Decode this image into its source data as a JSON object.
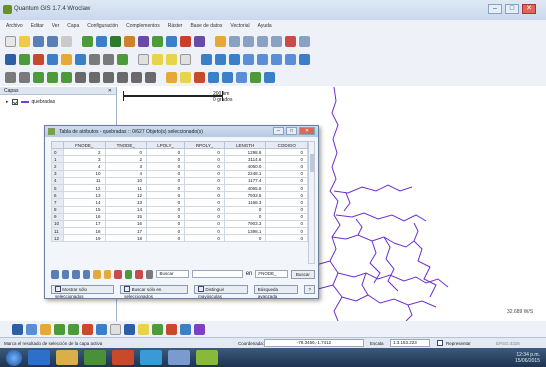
{
  "window": {
    "title": "Quantum GIS 1.7.4 Wroclaw",
    "minimize": "–",
    "maximize": "□",
    "close": "✕"
  },
  "menu": [
    "Archivo",
    "Editar",
    "Ver",
    "Capa",
    "Configuración",
    "Complementos",
    "Ráster",
    "Base de datos",
    "Vectorial",
    "Ayuda"
  ],
  "layers_panel": {
    "title": "Capas",
    "close": "✕",
    "layer_name": "quebradas",
    "layer_color": "#7b3fc8"
  },
  "map": {
    "scale_label": "200 km",
    "scale_sub": "0 grados",
    "river_color": "#6b2fd0"
  },
  "attribute_table": {
    "title": "Tabla de atributos - quebradas :: 0/627 Objeto(s) seleccionado(s)",
    "columns": [
      "",
      "FNODE_",
      "TNODE_",
      "LPOLY_",
      "RPOLY_",
      "LENGTH",
      "CODIGO"
    ],
    "rows": [
      [
        "0",
        "2",
        "0",
        "0",
        "0",
        "1298.6",
        "0"
      ],
      [
        "1",
        "3",
        "2",
        "0",
        "0",
        "3114.6",
        "0"
      ],
      [
        "2",
        "4",
        "3",
        "0",
        "0",
        "4060.0",
        "0"
      ],
      [
        "3",
        "10",
        "4",
        "0",
        "0",
        "2248.1",
        "0"
      ],
      [
        "4",
        "11",
        "10",
        "0",
        "0",
        "1177.4",
        "0"
      ],
      [
        "5",
        "12",
        "11",
        "0",
        "0",
        "4065.6",
        "0"
      ],
      [
        "6",
        "13",
        "12",
        "0",
        "0",
        "7933.5",
        "0"
      ],
      [
        "7",
        "14",
        "13",
        "0",
        "0",
        "1168.3",
        "0"
      ],
      [
        "8",
        "15",
        "14",
        "0",
        "0",
        "0",
        "0"
      ],
      [
        "9",
        "16",
        "15",
        "0",
        "0",
        "0",
        "0"
      ],
      [
        "10",
        "17",
        "16",
        "0",
        "0",
        "7903.3",
        "0"
      ],
      [
        "11",
        "18",
        "17",
        "0",
        "0",
        "1398.1",
        "0"
      ],
      [
        "12",
        "19",
        "18",
        "0",
        "0",
        "0",
        "0"
      ]
    ],
    "search_field": "Buscar",
    "search_in": "en",
    "field_select": "FNODE_",
    "search_button": "Buscar",
    "bottom_buttons": [
      "Mostrar sólo seleccionados",
      "Buscar sólo en seleccionados",
      "Distinguir mayúsculas",
      "Búsqueda avanzada"
    ],
    "help_label": "?"
  },
  "canvas_corner_text": "32.689 W/S",
  "statusbar": {
    "message": "Marca el resultado de selección de la capa activa",
    "coord_label": "Coordenada:",
    "coord_value": "-78.3456,-1.7412",
    "scale_label": "Escala",
    "scale_value": "1:3.163.223",
    "render_label": "Representar",
    "crs": "EPSG:4326"
  },
  "taskbar": {
    "time": "12:34 p.m.",
    "date": "15/06/2015"
  }
}
